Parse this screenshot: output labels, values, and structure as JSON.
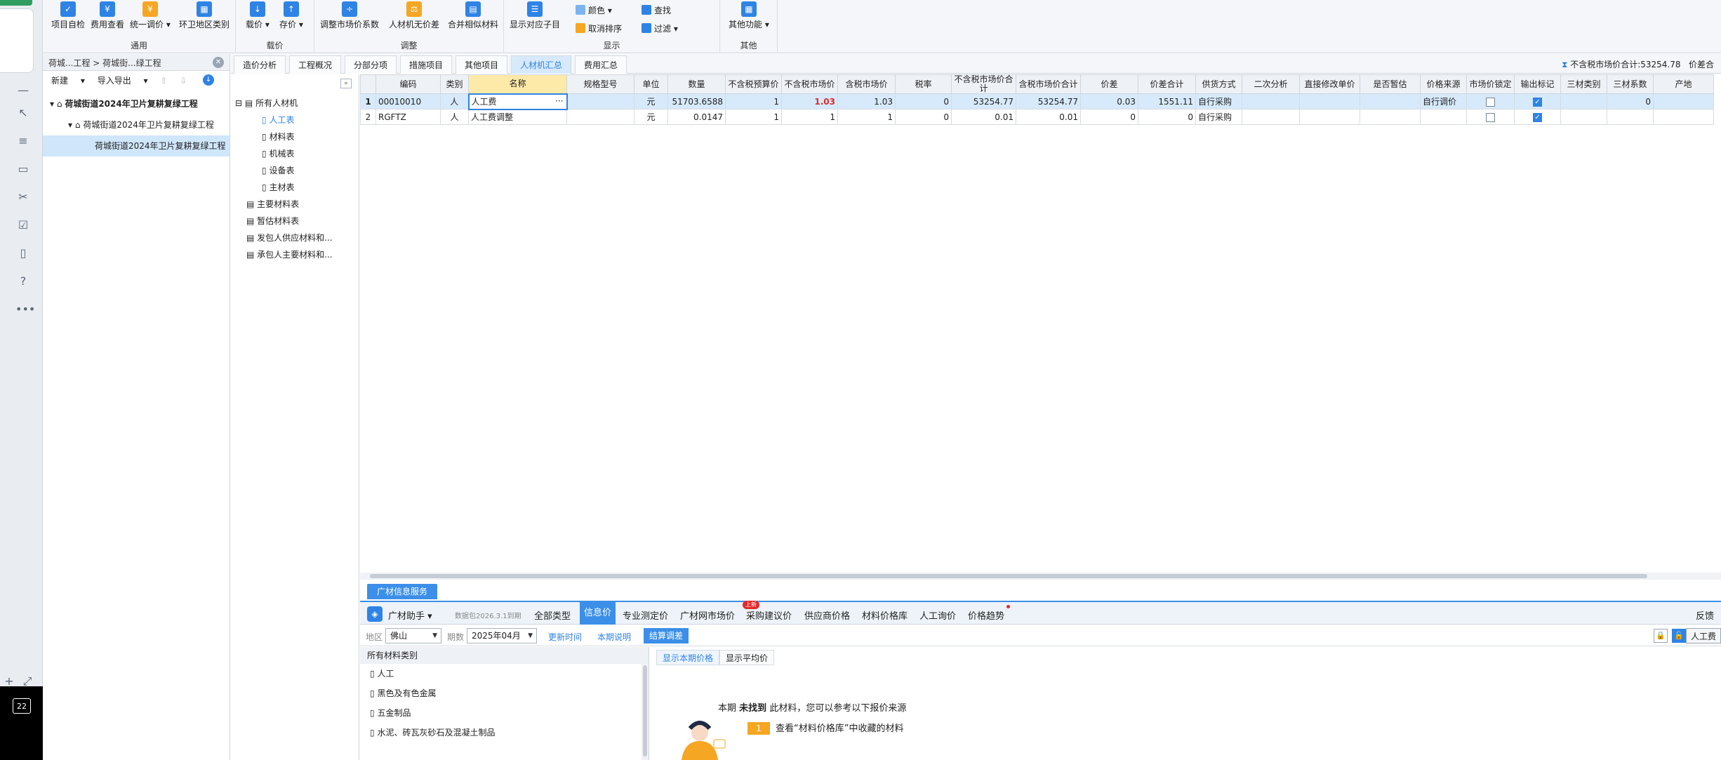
{
  "ribbon": {
    "groups": [
      {
        "title": "通用",
        "buttons": [
          "项目自检",
          "费用查看",
          "统一调价",
          "环卫地区类别"
        ]
      },
      {
        "title": "载价",
        "buttons": [
          "载价",
          "存价"
        ]
      },
      {
        "title": "调整",
        "buttons": [
          "调整市场价系数",
          "人材机无价差",
          "合并相似材料"
        ]
      },
      {
        "title": "显示",
        "buttons": [
          "显示对应子目"
        ],
        "small": [
          "颜色",
          "取消排序",
          "查找",
          "过滤"
        ]
      },
      {
        "title": "其他",
        "buttons": [
          "其他功能"
        ]
      }
    ]
  },
  "project": {
    "breadcrumb": "荷城...工程 > 荷城街...绿工程",
    "toolbar": [
      "新建",
      "导入导出"
    ],
    "nodes": [
      "荷城街道2024年卫片复耕复绿工程",
      "荷城街道2024年卫片复耕复绿工程",
      "荷城街道2024年卫片复耕复绿工程"
    ]
  },
  "tabs": [
    "造价分析",
    "工程概况",
    "分部分项",
    "措施项目",
    "其他项目",
    "人材机汇总",
    "费用汇总"
  ],
  "summary": {
    "label": "不含税市场价合计:53254.78",
    "extra": "价差合"
  },
  "category_tree": [
    "所有人材机",
    "人工表",
    "材料表",
    "机械表",
    "设备表",
    "主材表",
    "主要材料表",
    "暂估材料表",
    "发包人供应材料和...",
    "承包人主要材料和..."
  ],
  "grid": {
    "columns": [
      "编码",
      "类别",
      "名称",
      "规格型号",
      "单位",
      "数量",
      "不含税预算价",
      "不含税市场价",
      "含税市场价",
      "税率",
      "不含税市场价合计",
      "含税市场价合计",
      "价差",
      "价差合计",
      "供货方式",
      "二次分析",
      "直接修改单价",
      "是否暂估",
      "价格来源",
      "市场价锁定",
      "输出标记",
      "三材类别",
      "三材系数",
      "产地"
    ],
    "rows": [
      {
        "no": "1",
        "code": "00010010",
        "type": "人",
        "name": "人工费",
        "spec": "",
        "unit": "元",
        "qty": "51703.6588",
        "budget": "1",
        "market": "1.03",
        "tax_market": "1.03",
        "rate": "0",
        "total": "53254.77",
        "tax_total": "53254.77",
        "diff": "0.03",
        "diff_total": "1551.11",
        "supply": "自行采购",
        "source": "自行调价",
        "coef": "0"
      },
      {
        "no": "2",
        "code": "RGFTZ",
        "type": "人",
        "name": "人工费调整",
        "spec": "",
        "unit": "元",
        "qty": "0.0147",
        "budget": "1",
        "market": "1",
        "tax_market": "1",
        "rate": "0",
        "total": "0.01",
        "tax_total": "0.01",
        "diff": "0",
        "diff_total": "0",
        "supply": "自行采购",
        "source": "",
        "coef": ""
      }
    ]
  },
  "info": {
    "tab": "广材信息服务",
    "brand": "广材助手",
    "version": "数据包2026.3.1到期",
    "nav": [
      "全部类型",
      "信息价",
      "专业测定价",
      "广材网市场价",
      "采购建议价",
      "供应商价格",
      "材料价格库",
      "人工询价",
      "价格趋势"
    ],
    "new_badge": "上新",
    "feedback": "反馈",
    "region_label": "地区",
    "region": "佛山",
    "period_label": "期数",
    "period": "2025年04月",
    "links": [
      "更新时间",
      "本期说明"
    ],
    "apply_btn": "结算调差",
    "right_btn": "人工费",
    "cat_header": "所有材料类别",
    "cats": [
      "人工",
      "黑色及有色金属",
      "五金制品",
      "水泥、砖瓦灰砂石及混凝土制品"
    ],
    "price_tabs": [
      "显示本期价格",
      "显示平均价"
    ],
    "msg_pre": "本期",
    "msg_bold": "未找到",
    "msg_post": "此材料，您可以参考以下报价来源",
    "tip_no": "1",
    "tip": "查看“材料价格库”中收藏的材料"
  },
  "taskbar_badge": "22",
  "colors": {
    "accent": "#2f83e4",
    "selected_row": "#d7eafc",
    "red_value": "#e02a2a"
  }
}
